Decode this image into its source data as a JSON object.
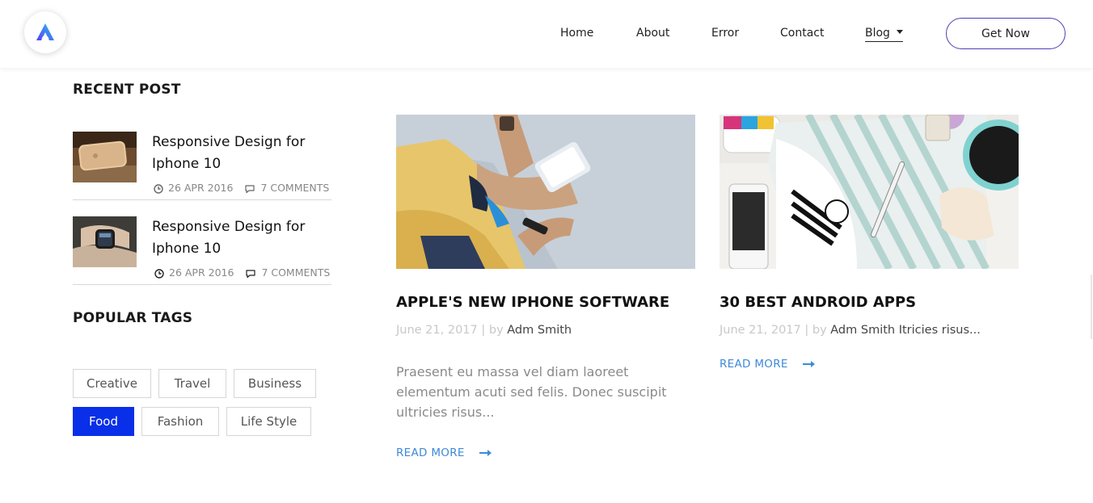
{
  "nav": {
    "items": [
      "Home",
      "About",
      "Error",
      "Contact",
      "Blog"
    ],
    "cta": "Get Now"
  },
  "sidebar": {
    "recent_title": "RECENT POST",
    "recent_posts": [
      {
        "title": "Responsive Design for Iphone 10",
        "date": "26 APR 2016",
        "comments": "7 COMMENTS"
      },
      {
        "title": "Responsive Design for Iphone 10",
        "date": "26 APR 2016",
        "comments": "7 COMMENTS"
      }
    ],
    "tags_title": "POPULAR TAGS",
    "tags": [
      "Creative",
      "Travel",
      "Business",
      "Food",
      "Fashion",
      "Life Style"
    ],
    "active_tag": "Food"
  },
  "posts": [
    {
      "title": "APPLE'S NEW IPHONE SOFTWARE",
      "date": "June 21, 2017",
      "by": "| by",
      "author": "Adm Smith",
      "excerpt": "Praesent eu massa vel diam laoreet elementum acuti sed felis. Donec suscipit ultricies risus...",
      "read_more": "READ MORE"
    },
    {
      "title": "30 BEST ANDROID APPS",
      "date": "June 21, 2017",
      "by": "| by",
      "author": "Adm Smith Itricies risus...",
      "read_more": "READ MORE"
    }
  ],
  "colors": {
    "accent": "#0a2fe8",
    "link": "#3e8ad8",
    "cta_border": "#4b3fb8"
  },
  "icons": {
    "logo": "logo-a-icon",
    "date": "clock-icon",
    "comments": "comment-icon",
    "read_more": "arrow-right-icon",
    "dropdown": "caret-down-icon"
  }
}
